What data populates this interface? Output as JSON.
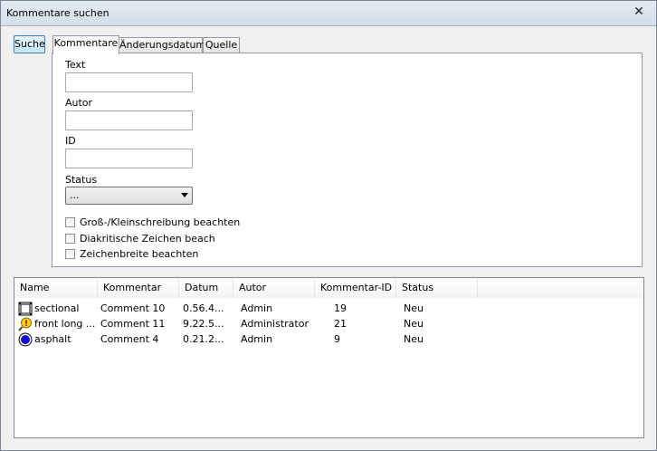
{
  "window": {
    "title": "Kommentare suchen",
    "close_glyph": "✕"
  },
  "search_button": "Suche",
  "tabs": [
    {
      "label": "Kommentare"
    },
    {
      "label": "Änderungsdatum"
    },
    {
      "label": "Quelle"
    }
  ],
  "form": {
    "text_label": "Text",
    "author_label": "Autor",
    "id_label": "ID",
    "status_label": "Status",
    "status_value": "...",
    "checkboxes": [
      {
        "label": "Groß-/Kleinschreibung beachten",
        "checked": false
      },
      {
        "label": "Diakritische Zeichen beach",
        "checked": false
      },
      {
        "label": "Zeichenbreite beachten",
        "checked": false
      }
    ]
  },
  "results": {
    "columns": [
      "Name",
      "Kommentar",
      "Datum",
      "Autor",
      "Kommentar-ID",
      "Status"
    ],
    "rows": [
      {
        "icon": "film-frame-icon",
        "name": "sectional",
        "comment": "Comment 10",
        "date": "0.56.4...",
        "author": "Admin",
        "id": "19",
        "status": "Neu"
      },
      {
        "icon": "warning-magnifier-icon",
        "name": "front long ...",
        "comment": "Comment 11",
        "date": "9.22.5...",
        "author": "Administrator",
        "id": "21",
        "status": "Neu"
      },
      {
        "icon": "blue-circle-icon",
        "name": "asphalt",
        "comment": "Comment 4",
        "date": "0.21.2...",
        "author": "Admin",
        "id": "9",
        "status": "Neu"
      }
    ]
  }
}
